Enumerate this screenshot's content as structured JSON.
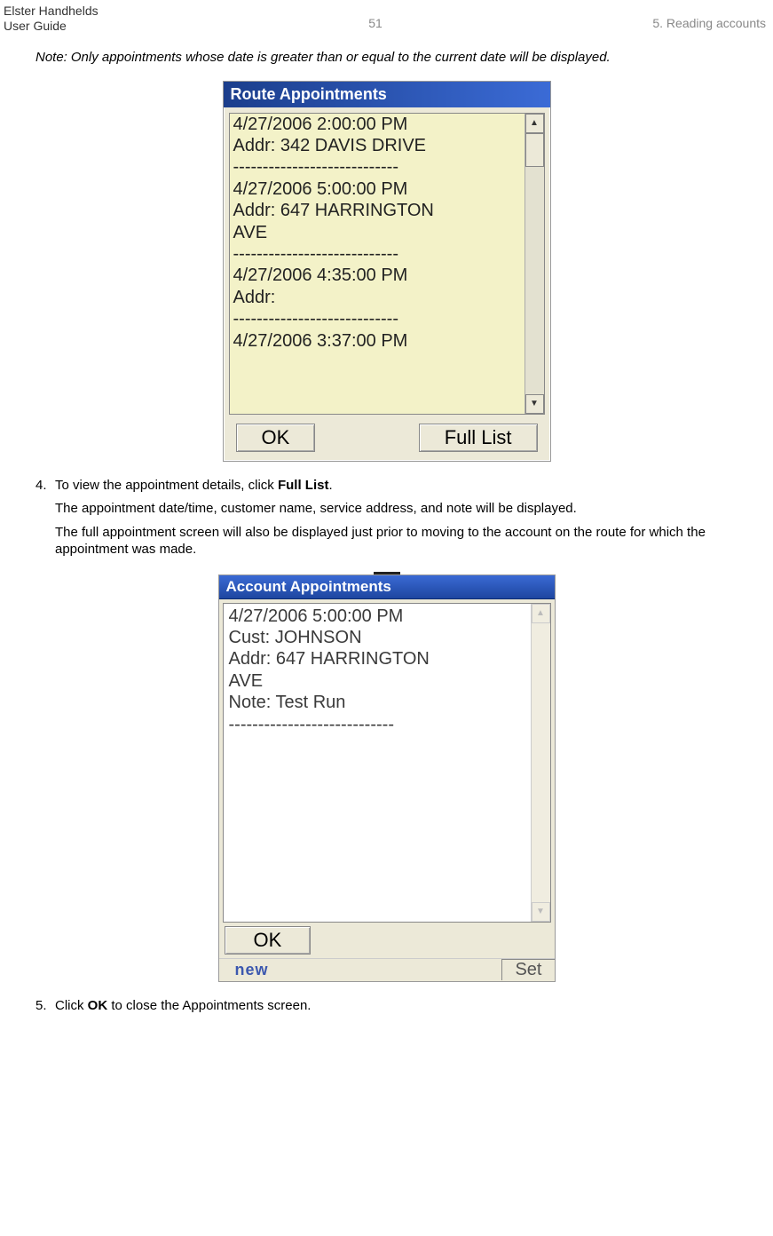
{
  "header": {
    "left_line1": "Elster Handhelds",
    "left_line2": "User Guide",
    "center": "51",
    "right": "5. Reading accounts"
  },
  "note": {
    "label": "Note:",
    "text": "Only appointments whose date is greater than or equal to the current date will be displayed."
  },
  "screenshot1": {
    "title": "Route Appointments",
    "listText": "4/27/2006 2:00:00 PM\nAddr: 342 DAVIS DRIVE\n----------------------------\n4/27/2006 5:00:00 PM\nAddr: 647 HARRINGTON\nAVE\n----------------------------\n4/27/2006 4:35:00 PM\nAddr:\n----------------------------\n4/27/2006 3:37:00 PM",
    "okLabel": "OK",
    "fullListLabel": "Full List"
  },
  "step4": {
    "num": "4.",
    "line1a": "To view the appointment details, click ",
    "line1b": "Full List",
    "line1c": ".",
    "para2": "The appointment date/time, customer name, service address, and note will be displayed.",
    "para3": "The full appointment screen will also be displayed just prior to moving to the account on the route for which the appointment was made."
  },
  "screenshot2": {
    "title": "Account Appointments",
    "listText": "4/27/2006 5:00:00 PM\nCust: JOHNSON\nAddr: 647 HARRINGTON\nAVE\nNote:  Test Run\n----------------------------",
    "okLabel": "OK",
    "partialBlue": "new",
    "partialCut": "Set"
  },
  "step5": {
    "num": "5.",
    "line1a": "Click ",
    "line1b": "OK",
    "line1c": " to close the Appointments screen."
  }
}
